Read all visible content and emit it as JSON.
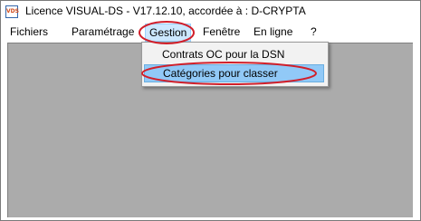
{
  "window": {
    "title": "Licence VISUAL-DS - V17.12.10, accordée à : D-CRYPTA",
    "icon_label": "VDS"
  },
  "menubar": {
    "items": [
      {
        "label": "Fichiers"
      },
      {
        "label": "Paramétrage"
      },
      {
        "label": "Gestion"
      },
      {
        "label": "Fenêtre"
      },
      {
        "label": "En ligne"
      },
      {
        "label": "?"
      }
    ]
  },
  "gestion_menu": {
    "items": [
      {
        "label": "Contrats OC pour la DSN"
      },
      {
        "label": "Catégories pour classer"
      }
    ]
  },
  "colors": {
    "annotation": "#d11f2a",
    "workspace": "#ababab",
    "menu_highlight": "#91c9f7"
  }
}
